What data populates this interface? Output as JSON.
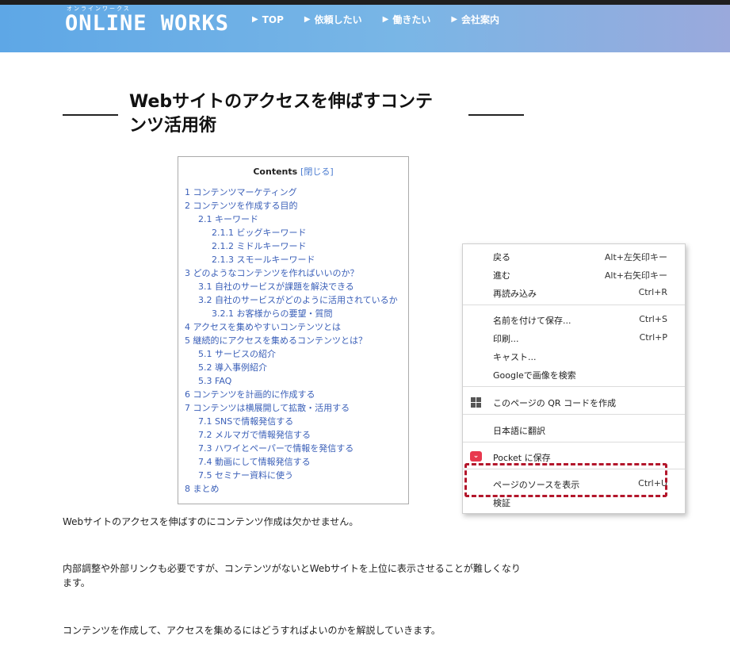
{
  "header": {
    "logo_sub": "オンラインワークス",
    "logo": "ONLINE WORKS",
    "nav": [
      {
        "arrow": "▶",
        "label": "TOP"
      },
      {
        "arrow": "▶",
        "label": "依頼したい"
      },
      {
        "arrow": "▶",
        "label": "働きたい"
      },
      {
        "arrow": "▶",
        "label": "会社案内"
      }
    ]
  },
  "article": {
    "title_line1": "Webサイトのアクセスを伸ばすコンテ",
    "title_line2": "ンツ活用術"
  },
  "toc": {
    "heading": "Contents",
    "toggle": "[閉じる]",
    "items": [
      {
        "num": "1",
        "label": "コンテンツマーケティング",
        "level": 1
      },
      {
        "num": "2",
        "label": "コンテンツを作成する目的",
        "level": 1
      },
      {
        "num": "2.1",
        "label": "キーワード",
        "level": 2
      },
      {
        "num": "2.1.1",
        "label": "ビッグキーワード",
        "level": 3
      },
      {
        "num": "2.1.2",
        "label": "ミドルキーワード",
        "level": 3
      },
      {
        "num": "2.1.3",
        "label": "スモールキーワード",
        "level": 3
      },
      {
        "num": "3",
        "label": "どのようなコンテンツを作ればいいのか？",
        "level": 1
      },
      {
        "num": "3.1",
        "label": "自社のサービスが課題を解決できる",
        "level": 2
      },
      {
        "num": "3.2",
        "label": "自社のサービスがどのように活用されているか",
        "level": 2
      },
      {
        "num": "3.2.1",
        "label": "お客様からの要望・質問",
        "level": 3
      },
      {
        "num": "4",
        "label": "アクセスを集めやすいコンテンツとは",
        "level": 1
      },
      {
        "num": "5",
        "label": "継続的にアクセスを集めるコンテンツとは？",
        "level": 1
      },
      {
        "num": "5.1",
        "label": "サービスの紹介",
        "level": 2
      },
      {
        "num": "5.2",
        "label": "導入事例紹介",
        "level": 2
      },
      {
        "num": "5.3",
        "label": " FAQ",
        "level": 2
      },
      {
        "num": "6",
        "label": "コンテンツを計画的に作成する",
        "level": 1
      },
      {
        "num": "7",
        "label": "コンテンツは横展開して拡散・活用する",
        "level": 1
      },
      {
        "num": "7.1",
        "label": "SNSで情報発信する",
        "level": 2
      },
      {
        "num": "7.2",
        "label": "メルマガで情報発信する",
        "level": 2
      },
      {
        "num": "7.3",
        "label": "ハワイとペーパーで情報を発信する",
        "level": 2
      },
      {
        "num": "7.4",
        "label": "動画にして情報発信する",
        "level": 2
      },
      {
        "num": "7.5",
        "label": "セミナー資料に使う",
        "level": 2
      },
      {
        "num": "8",
        "label": "まとめ",
        "level": 1
      }
    ]
  },
  "body": {
    "p1": "Webサイトのアクセスを伸ばすのにコンテンツ作成は欠かせません。",
    "p2a": "内部調整や外部リンクも必要ですが、コンテンツがないとWebサイトを上位に表示させることが難しくなり",
    "p2b": "ます。",
    "p3": "コンテンツを作成して、アクセスを集めるにはどうすればよいのかを解説していきます。"
  },
  "context_menu": {
    "back": {
      "label": "戻る",
      "shortcut": "Alt+左矢印キー"
    },
    "forward": {
      "label": "進む",
      "shortcut": "Alt+右矢印キー"
    },
    "reload": {
      "label": "再読み込み",
      "shortcut": "Ctrl+R"
    },
    "save_as": {
      "label": "名前を付けて保存...",
      "shortcut": "Ctrl+S"
    },
    "print": {
      "label": "印刷...",
      "shortcut": "Ctrl+P"
    },
    "cast": {
      "label": "キャスト..."
    },
    "google_image_search": {
      "label": "Googleで画像を検索"
    },
    "qr_code": {
      "label": "このページの QR コードを作成"
    },
    "translate": {
      "label": "日本語に翻訳"
    },
    "pocket": {
      "label": "Pocket に保存"
    },
    "view_source": {
      "label": "ページのソースを表示",
      "shortcut": "Ctrl+U"
    },
    "inspect": {
      "label": "検証"
    }
  },
  "colors": {
    "highlight_border": "#b3162b",
    "toc_link": "#3a5fb8"
  }
}
